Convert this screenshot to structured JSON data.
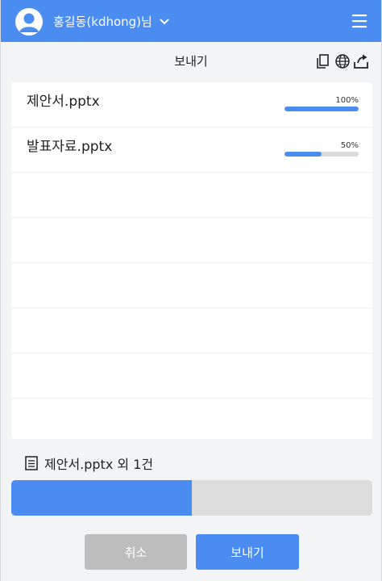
{
  "header": {
    "user_name": "홍길동(kdhong)님",
    "brand_color": "#4b8cf0",
    "icons": [
      "user-avatar-icon",
      "chevron-down-icon",
      "hamburger-menu-icon"
    ]
  },
  "toolbar": {
    "title": "보내기",
    "icons": [
      "copy-icon",
      "globe-icon",
      "upload-icon"
    ]
  },
  "files": [
    {
      "name": "제안서.pptx",
      "percent_label": "100%",
      "progress": 1.0
    },
    {
      "name": "발표자료.pptx",
      "percent_label": "50%",
      "progress": 0.5
    }
  ],
  "summary": {
    "icon": "document-icon",
    "text": "제안서.pptx 외 1건",
    "overall_progress": 0.5
  },
  "buttons": {
    "cancel_label": "취소",
    "send_label": "보내기"
  },
  "colors": {
    "accent": "#4b8cf0",
    "track": "#dcdcdc",
    "cancel": "#bdbdbd",
    "background": "#f3f4f6"
  }
}
